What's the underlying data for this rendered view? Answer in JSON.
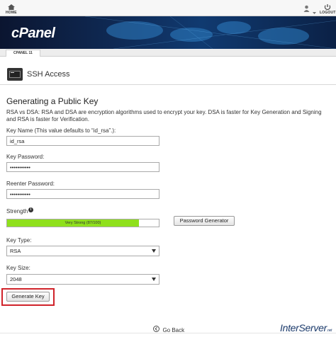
{
  "topnav": {
    "home_label": "HOME",
    "logout_label": "LOGOUT"
  },
  "header": {
    "logo_text": "cPanel",
    "subtab_label": "CPANEL 11"
  },
  "page": {
    "title": "SSH Access",
    "section_heading": "Generating a Public Key",
    "description": "RSA vs DSA: RSA and DSA are encryption algorithms used to encrypt your key. DSA is faster for Key Generation and Signing and RSA is faster for Verification."
  },
  "form": {
    "key_name_label": "Key Name (This value defaults to “id_rsa”.):",
    "key_name_value": "id_rsa",
    "key_password_label": "Key Password:",
    "key_password_value": "•••••••••••",
    "reenter_password_label": "Reenter Password:",
    "reenter_password_value": "•••••••••••",
    "strength_label": "Strength",
    "strength_text": "Very Strong (87/100)",
    "strength_percent": 87,
    "strength_color": "#8fe01c",
    "password_generator_label": "Password Generator",
    "key_type_label": "Key Type:",
    "key_type_value": "RSA",
    "key_size_label": "Key Size:",
    "key_size_value": "2048",
    "generate_key_label": "Generate Key",
    "highlight_color": "#d0232a"
  },
  "footer": {
    "go_back_label": "Go Back",
    "brand_text": "InterServer",
    "brand_suffix": ".net"
  }
}
